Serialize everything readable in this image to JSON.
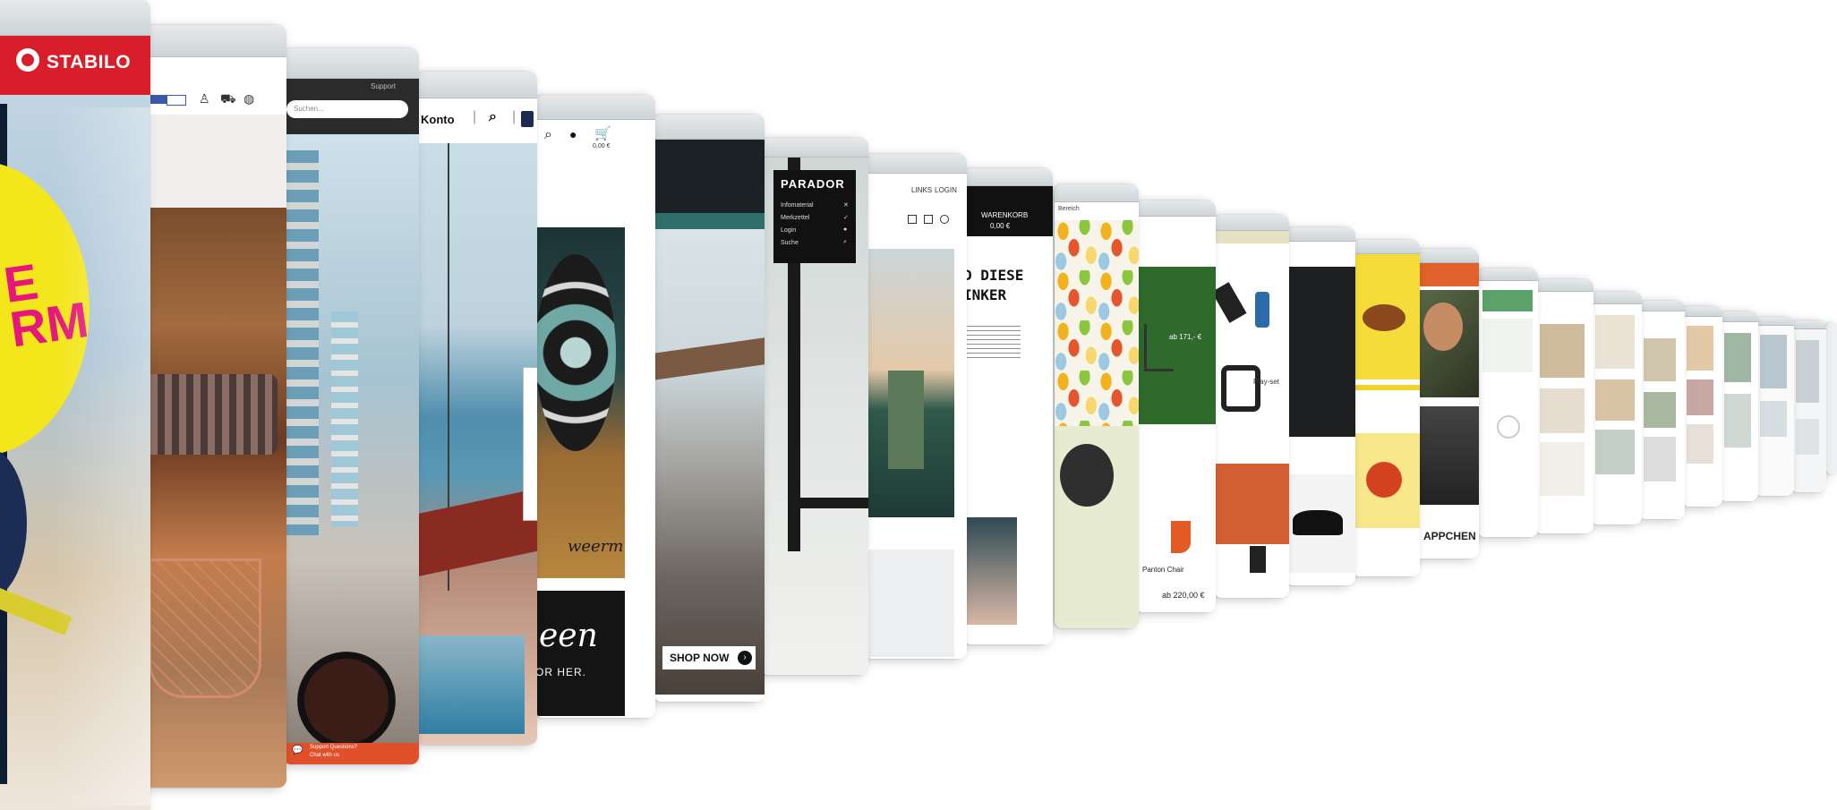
{
  "stabilo": {
    "logo": "STABILO",
    "big_letters": "E\nRM"
  },
  "card2": {
    "btn1": "",
    "btn2": ""
  },
  "card3": {
    "support": "Support",
    "search_placeholder": "Suchen...",
    "chat_line1": "Support Questions?",
    "chat_line2": "Chat with us"
  },
  "card4": {
    "konto": "Konto"
  },
  "card5": {
    "price": "0,00 €",
    "script": "weerm",
    "sale_word": "een",
    "sale_sub": "OR HER."
  },
  "card6": {
    "shop_now": "SHOP NOW"
  },
  "parador": {
    "brand": "PARADOR",
    "menu": [
      "Infomaterial",
      "Merkzettel",
      "Login",
      "Suche"
    ]
  },
  "card8": {
    "nav1": "LINKS",
    "nav2": "LOGIN"
  },
  "card9": {
    "headline1": "D DIESE",
    "headline2": "INKER",
    "cart_label": "WARENKORB",
    "cart_price": "0,00 €"
  },
  "card10": {
    "label": "Bereich"
  },
  "card11": {
    "price": "ab 220,00 €",
    "product": "Panton Chair",
    "small_price": "ab 171,- €"
  },
  "card12": {
    "tag": "Play-set"
  },
  "card16": {
    "word": "APPCHEN"
  }
}
